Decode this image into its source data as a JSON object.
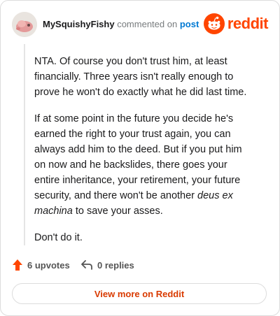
{
  "comment": {
    "author": "MySquishyFishy",
    "action_text": "commented on",
    "target_link": "post",
    "paragraphs": [
      {
        "text": "NTA. Of course you don't trust him, at least financially. Three years isn't really enough to prove he won't do exactly what he did last time."
      },
      {
        "text": "If at some point in the future you decide he's earned the right to your trust again, you can always add him to the deed. But if you put him on now and he backslides, there goes your entire inheritance, your retirement, your future security, and there won't be another "
      },
      {
        "text": "Don't do it."
      }
    ],
    "italic_phrase": "deus ex machina",
    "after_italic": " to save your asses."
  },
  "brand": {
    "logo_text": "reddit",
    "accent_color": "#ff4500",
    "logo_icon": "reddit-snoo-icon"
  },
  "footer": {
    "upvotes_label": "6 upvotes",
    "replies_label": "0 replies",
    "upvote_icon": "upvote-arrow-icon",
    "reply_icon": "reply-arrow-icon",
    "upvote_color": "#ff4500"
  },
  "cta": {
    "view_more_label": "View more on Reddit",
    "color": "#d93a00"
  }
}
